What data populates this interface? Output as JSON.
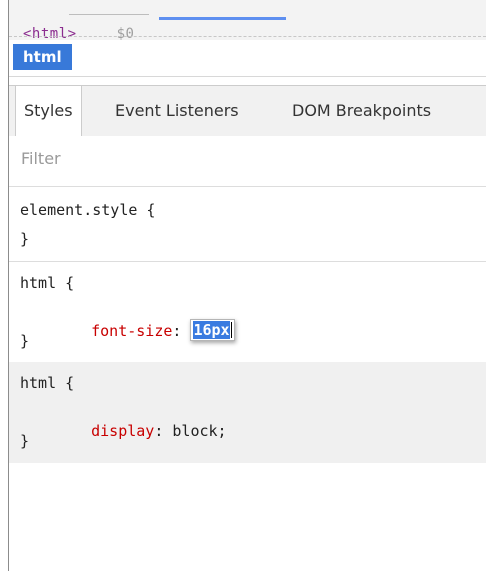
{
  "top_strip": {
    "cut_text": "<html>",
    "cut_attr": "$0"
  },
  "breadcrumb": {
    "items": [
      "html"
    ]
  },
  "tabs": [
    "Styles",
    "Event Listeners",
    "DOM Breakpoints"
  ],
  "filter": {
    "placeholder": "Filter",
    "value": ""
  },
  "rules": [
    {
      "selector": "element.style {",
      "properties": [],
      "close": "}"
    },
    {
      "selector": "html {",
      "properties": [
        {
          "name": "font-size",
          "value": "16px"
        }
      ],
      "close": "}"
    },
    {
      "selector": "html {",
      "properties": [
        {
          "name": "display",
          "value": "block;"
        }
      ],
      "close": "}"
    }
  ],
  "colors": {
    "accent": "#3879d9",
    "property_name": "#c80000",
    "selection": "#3a7be0"
  }
}
